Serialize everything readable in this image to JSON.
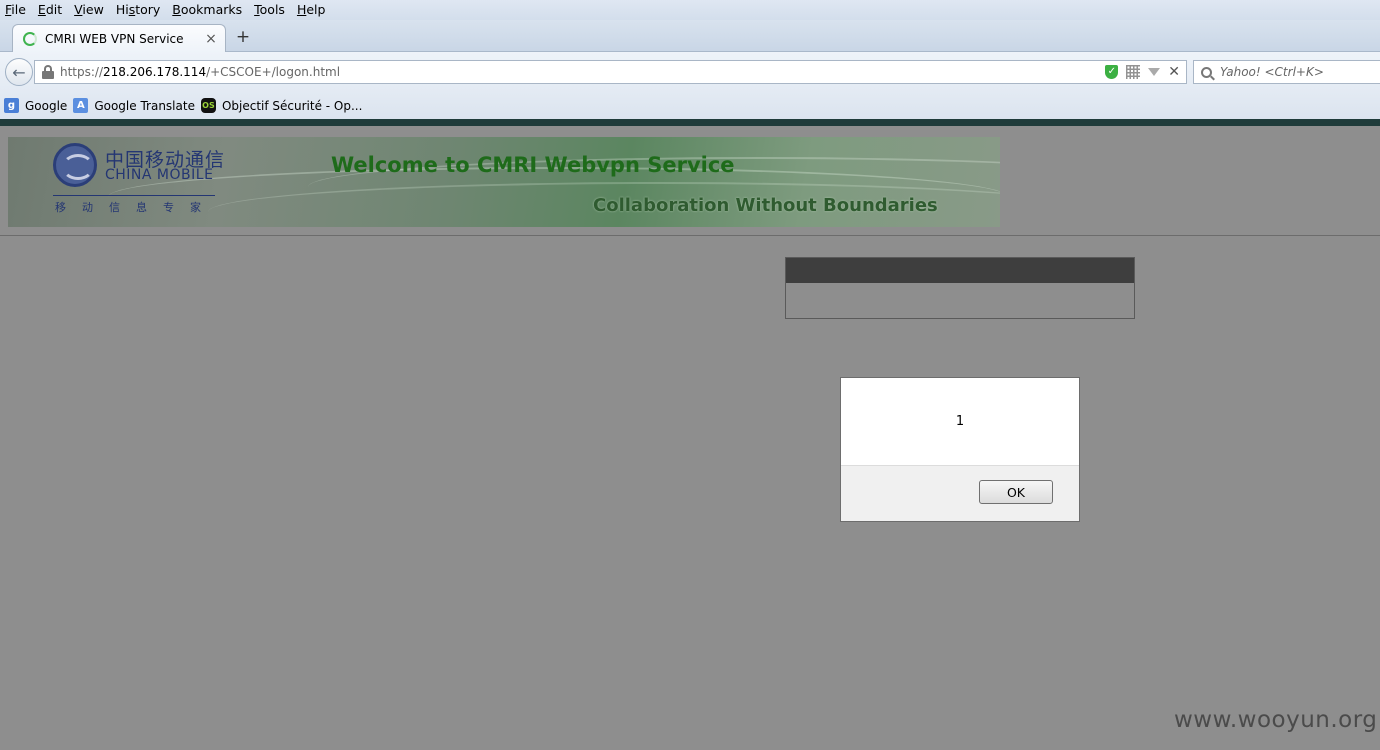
{
  "menubar": {
    "items": [
      {
        "label_u": "F",
        "label_rest": "ile"
      },
      {
        "label_u": "E",
        "label_rest": "dit"
      },
      {
        "label_u": "V",
        "label_rest": "iew"
      },
      {
        "label_pre": "Hi",
        "label_u": "s",
        "label_rest": "tory"
      },
      {
        "label_u": "B",
        "label_rest": "ookmarks"
      },
      {
        "label_u": "T",
        "label_rest": "ools"
      },
      {
        "label_u": "H",
        "label_rest": "elp"
      }
    ]
  },
  "tab": {
    "title": "CMRI WEB VPN Service",
    "close_glyph": "×"
  },
  "newtab_glyph": "+",
  "navbar": {
    "back_glyph": "←",
    "url_prefix": "https://",
    "url_host": "218.206.178.114",
    "url_path": "/+CSCOE+/logon.html",
    "shield_glyph": "✓",
    "stop_glyph": "✕",
    "search_placeholder": "Yahoo! <Ctrl+K>"
  },
  "bookmarks": [
    {
      "label": "Google",
      "icon": "google-icon",
      "glyph": "g"
    },
    {
      "label": "Google Translate",
      "icon": "google-translate-icon",
      "glyph": "A"
    },
    {
      "label": "Objectif Sécurité - Op...",
      "icon": "objectif-securite-icon",
      "glyph": "OS"
    }
  ],
  "banner": {
    "logo_cn": "中国移动通信",
    "logo_en": "CHINA MOBILE",
    "logo_sub": "移动信息专家",
    "title": "Welcome to CMRI Webvpn Service",
    "subtitle": "Collaboration Without Boundaries"
  },
  "dialog": {
    "message": "1",
    "ok_label": "OK"
  },
  "watermark": "www.wooyun.org"
}
